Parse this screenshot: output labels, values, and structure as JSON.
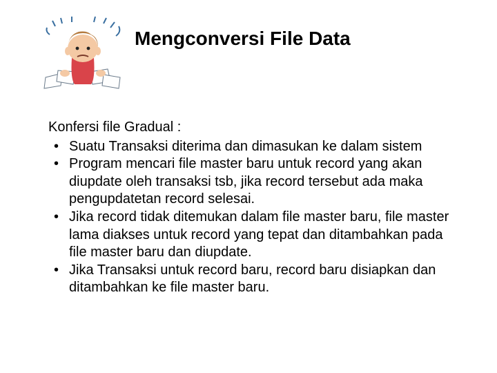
{
  "title": "Mengconversi File Data",
  "intro": "Konfersi file Gradual :",
  "bullets": [
    "Suatu Transaksi diterima dan dimasukan ke dalam sistem",
    "Program mencari file master baru untuk record yang akan diupdate oleh transaksi tsb, jika record tersebut ada maka pengupdatetan record selesai.",
    "Jika record tidak ditemukan dalam file master baru, file master lama diakses untuk record yang tepat dan ditambahkan pada file master baru dan diupdate.",
    "Jika Transaksi untuk record baru, record baru disiapkan dan ditambahkan ke file master baru."
  ],
  "illustration_alt": "confused-person-with-papers"
}
